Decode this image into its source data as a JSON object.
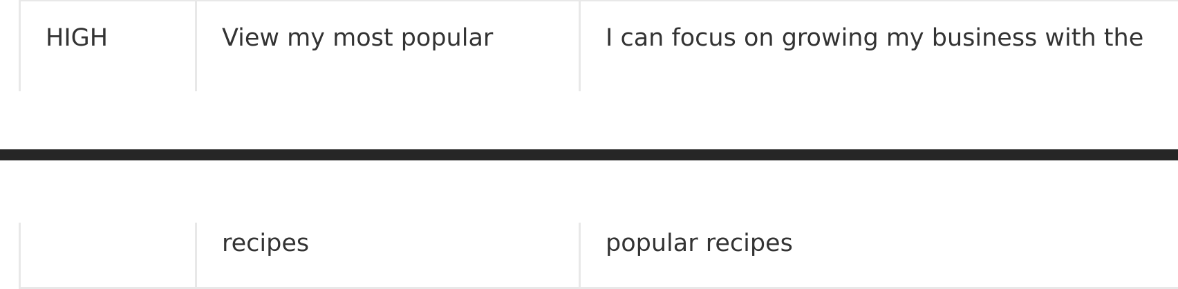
{
  "table": {
    "top_row": {
      "priority": "HIGH",
      "feature": "View my most popular",
      "benefit": "I can focus on growing my business with the"
    },
    "bottom_row": {
      "priority": "",
      "feature": "recipes",
      "benefit": "popular recipes"
    }
  }
}
